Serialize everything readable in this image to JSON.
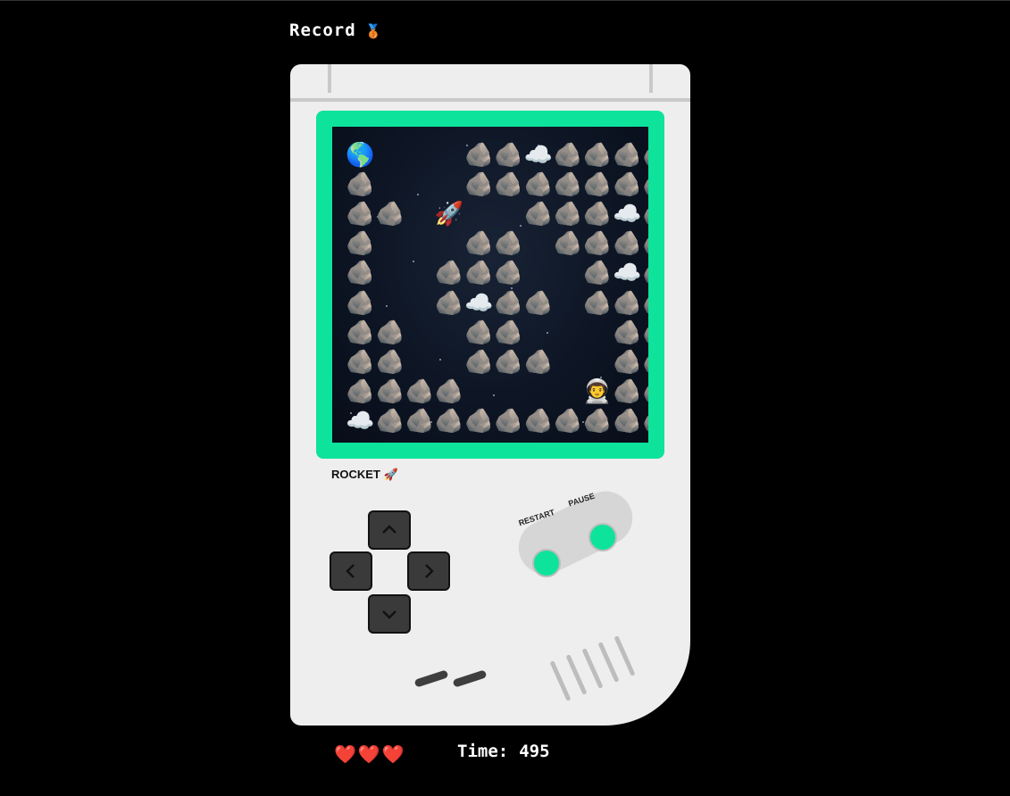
{
  "header": {
    "record_label": "Record",
    "record_icon": "🥉"
  },
  "console": {
    "brand_label": "ROCKET",
    "brand_icon": "🚀",
    "restart_label": "RESTART",
    "pause_label": "PAUSE"
  },
  "game": {
    "legend": {
      "R": "rock",
      "C": "cloud",
      "E": "earth",
      "P": "rocket",
      "A": "astronaut",
      ".": "empty"
    },
    "glyphs": {
      "rock": "🪨",
      "cloud": "☁️",
      "earth": "🌎",
      "rocket": "🚀",
      "astronaut": "👨‍🚀"
    },
    "grid": [
      "E...RRCRRRR",
      "R...RRRRRRR",
      "RR.P..RRRCR",
      "R...RR.RRRR",
      "R..RRR..RCR",
      "R..RCRR.RRR",
      "RR..RR...RR",
      "RR..RRR..RR",
      "RRRR....ARR",
      "CRRRRRRRRRR"
    ]
  },
  "status": {
    "lives": 3,
    "heart_icon": "❤️",
    "time_label": "Time:",
    "time_value": "495"
  }
}
